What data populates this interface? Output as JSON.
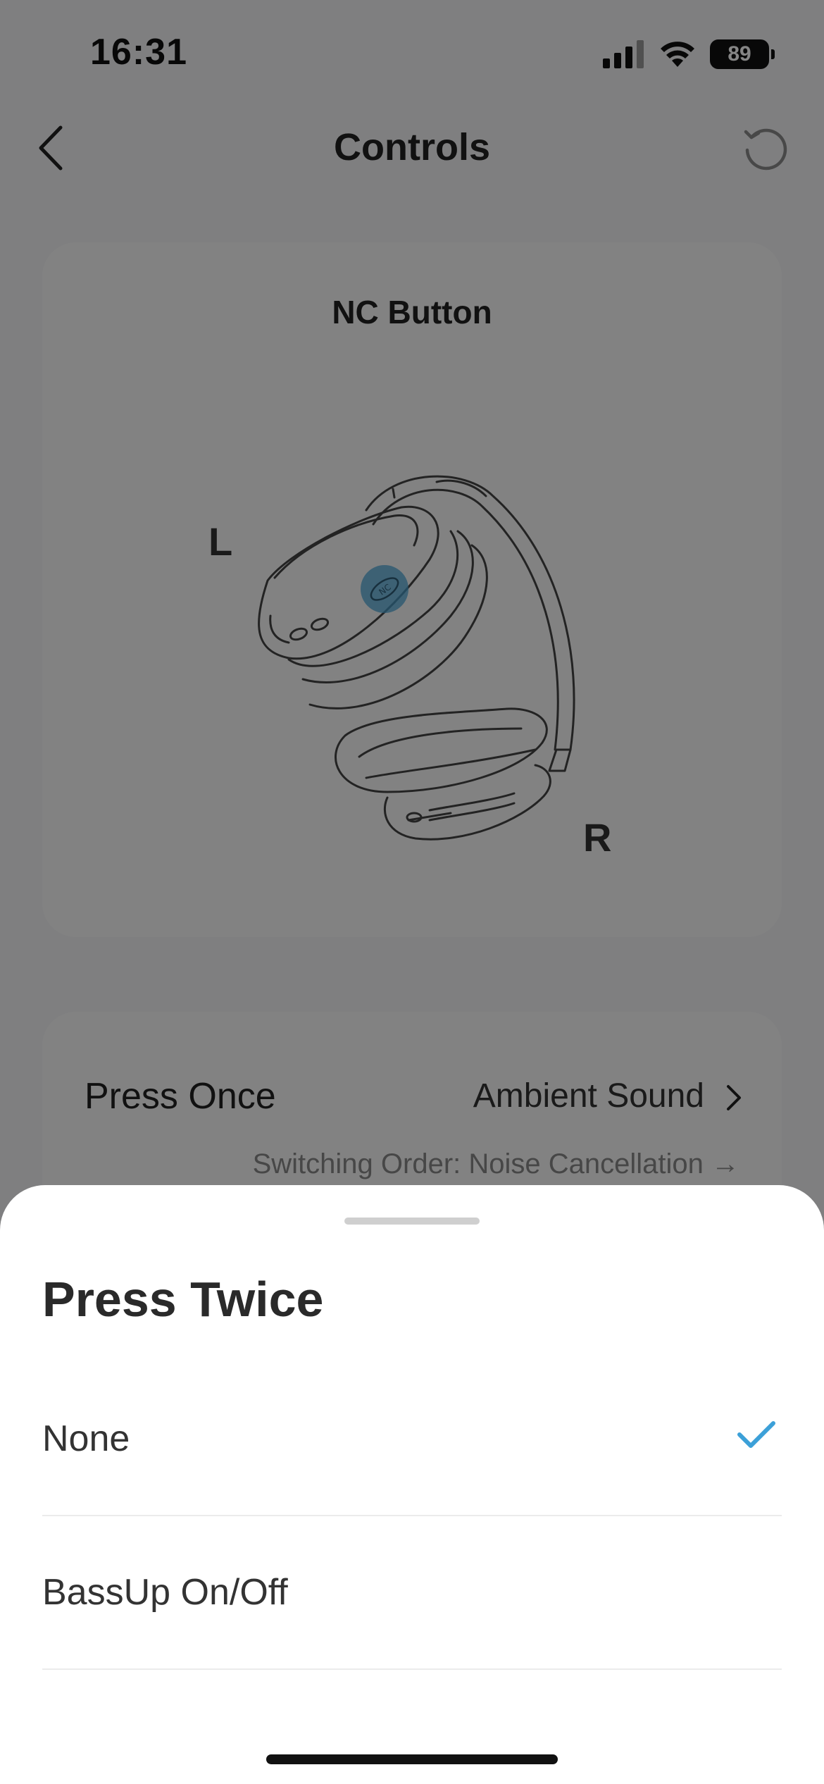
{
  "status_bar": {
    "time": "16:31",
    "battery": "89",
    "icons": [
      "signal-icon",
      "wifi-icon",
      "battery-icon"
    ]
  },
  "nav": {
    "title": "Controls",
    "back_icon": "chevron-left-icon",
    "reset_icon": "reset-icon"
  },
  "illustration_card": {
    "title": "NC Button",
    "left_label": "L",
    "right_label": "R",
    "button_mark": "NC"
  },
  "controls_card": {
    "press_once_label": "Press Once",
    "press_once_value": "Ambient Sound",
    "switching_order": "Switching Order: Noise Cancellation →"
  },
  "sheet": {
    "title": "Press Twice",
    "options": [
      {
        "label": "None",
        "selected": true
      },
      {
        "label": "BassUp On/Off",
        "selected": false
      }
    ]
  },
  "colors": {
    "accent": "#3ca0d8",
    "overlay": "rgba(0,0,0,0.48)",
    "sheet_background": "#ffffff"
  }
}
